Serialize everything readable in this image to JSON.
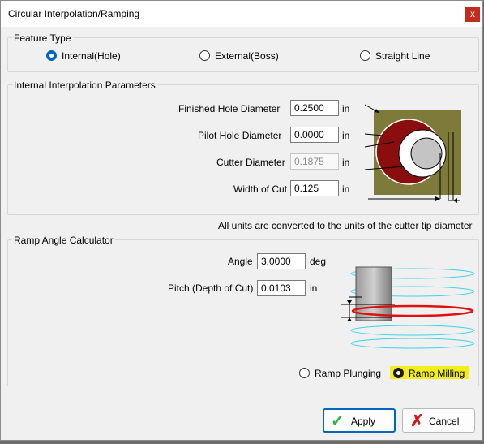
{
  "window": {
    "title": "Circular Interpolation/Ramping",
    "close_glyph": "x"
  },
  "feature_type": {
    "title": "Feature Type",
    "options": [
      "Internal(Hole)",
      "External(Boss)",
      "Straight Line"
    ],
    "selected": "Internal(Hole)"
  },
  "params": {
    "title": "Internal Interpolation Parameters",
    "finished_hole_label": "Finished Hole Diameter",
    "finished_hole_value": "0.2500",
    "pilot_hole_label": "Pilot Hole Diameter",
    "pilot_hole_value": "0.0000",
    "cutter_label": "Cutter Diameter",
    "cutter_value": "0.1875",
    "width_label": "Width of Cut",
    "width_value": "0.125",
    "unit": "in"
  },
  "units_note": "All units are converted to the units of the cutter tip diameter",
  "ramp": {
    "title": "Ramp Angle Calculator",
    "angle_label": "Angle",
    "angle_value": "3.0000",
    "angle_unit": "deg",
    "pitch_label": "Pitch (Depth of Cut)",
    "pitch_value": "0.0103",
    "pitch_unit": "in",
    "mode_options": [
      "Ramp Plunging",
      "Ramp Milling"
    ],
    "selected_mode": "Ramp Milling"
  },
  "buttons": {
    "apply": "Apply",
    "cancel": "Cancel",
    "apply_icon": "✓",
    "cancel_icon": "✗"
  },
  "colors": {
    "accent": "#0067c0",
    "close": "#c42b1c",
    "highlight": "#f2ee1b",
    "diagram_bg": "#7d7a3a",
    "ring": "#8b0e0e"
  }
}
